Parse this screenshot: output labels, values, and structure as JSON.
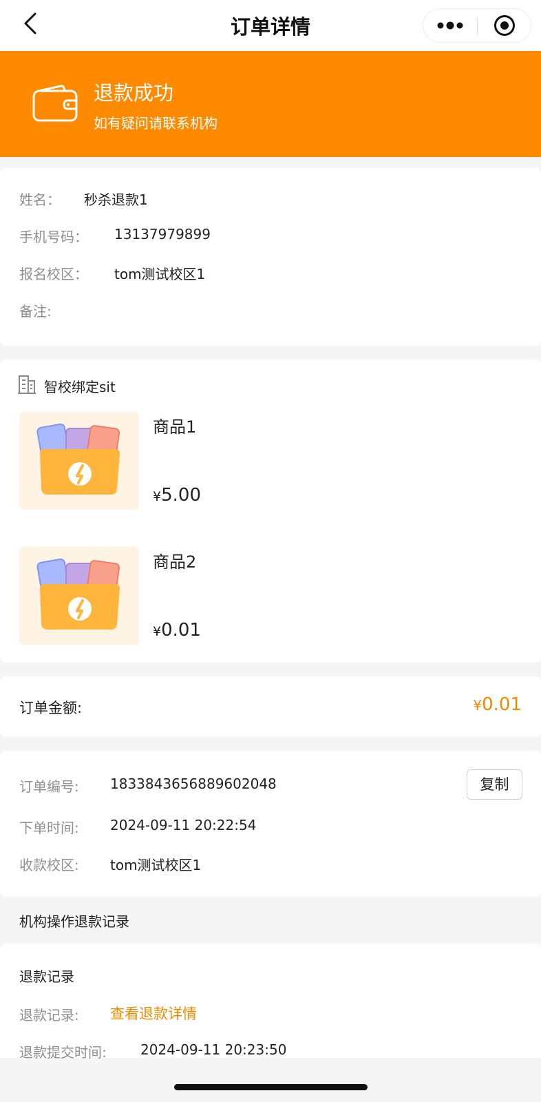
{
  "navbar": {
    "title": "订单详情"
  },
  "status": {
    "title": "退款成功",
    "subtitle": "如有疑问请联系机构",
    "color": "#ff8a00"
  },
  "student": {
    "name_label": "姓名：",
    "name_value": "秒杀退款1",
    "phone_label": "手机号码：",
    "phone_value": "13137979899",
    "campus_label": "报名校区：",
    "campus_value": "tom测试校区1",
    "remark_label": "备注:"
  },
  "goods": {
    "shop_name": "智校绑定sit",
    "items": [
      {
        "name": "商品1",
        "currency": "¥",
        "price": "5.00"
      },
      {
        "name": "商品2",
        "currency": "¥",
        "price": "0.01"
      }
    ]
  },
  "amount": {
    "label": "订单金额:",
    "currency": "¥",
    "value": "0.01",
    "accent_color": "#f08a00"
  },
  "order": {
    "number_label": "订单编号:",
    "number_value": "1833843656889602048",
    "copy_label": "复制",
    "time_label": "下单时间:",
    "time_value": "2024-09-11 20:22:54",
    "campus_label": "收款校区:",
    "campus_value": "tom测试校区1"
  },
  "refund": {
    "section_title": "机构操作退款记录",
    "heading": "退款记录",
    "record_label": "退款记录:",
    "record_link": "查看退款详情",
    "submit_label": "退款提交时间:",
    "submit_value": "2024-09-11 20:23:50"
  },
  "icons": {
    "back": "chevron-left-icon",
    "more": "more-dots-icon",
    "target": "target-icon",
    "wallet": "wallet-icon",
    "shop": "building-icon",
    "goods": "folder-icon"
  }
}
